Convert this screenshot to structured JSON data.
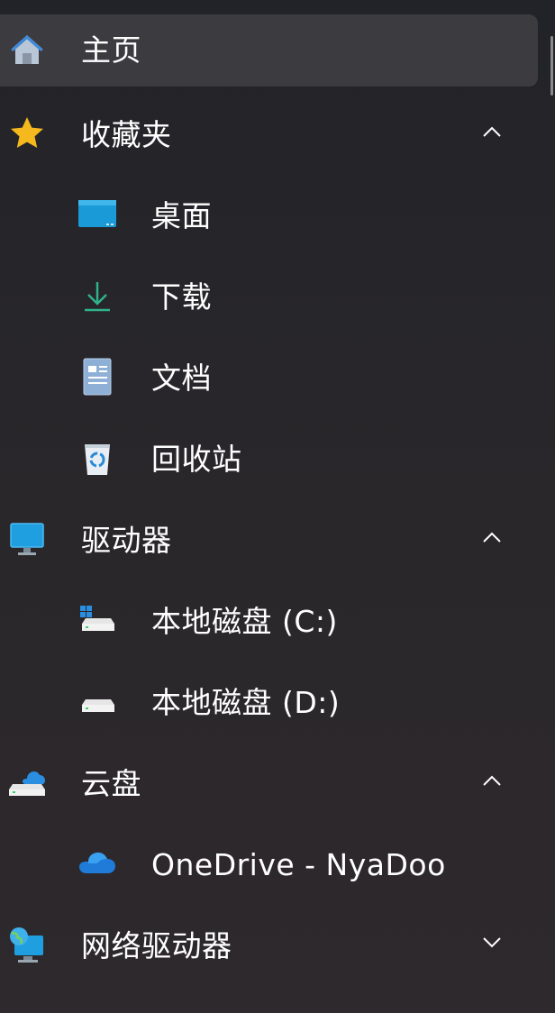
{
  "nav": {
    "home": {
      "label": "主页",
      "icon": "home-icon"
    },
    "favorites": {
      "label": "收藏夹",
      "icon": "star-icon",
      "expanded": true,
      "items": [
        {
          "label": "桌面",
          "icon": "desktop-folder-icon"
        },
        {
          "label": "下载",
          "icon": "download-icon"
        },
        {
          "label": "文档",
          "icon": "document-icon"
        },
        {
          "label": "回收站",
          "icon": "recycle-bin-icon"
        }
      ]
    },
    "drives": {
      "label": "驱动器",
      "icon": "monitor-icon",
      "expanded": true,
      "items": [
        {
          "label": "本地磁盘 (C:)",
          "icon": "system-drive-icon"
        },
        {
          "label": "本地磁盘 (D:)",
          "icon": "drive-icon"
        }
      ]
    },
    "cloud": {
      "label": "云盘",
      "icon": "cloud-drive-icon",
      "expanded": true,
      "items": [
        {
          "label": "OneDrive - NyaDoo",
          "icon": "onedrive-icon"
        }
      ]
    },
    "network": {
      "label": "网络驱动器",
      "icon": "network-drive-icon",
      "expanded": false
    }
  },
  "colors": {
    "background": "#25252a",
    "selected_row": "#3b3b40",
    "text": "#ffffff",
    "accent_download": "#2fb38a"
  }
}
